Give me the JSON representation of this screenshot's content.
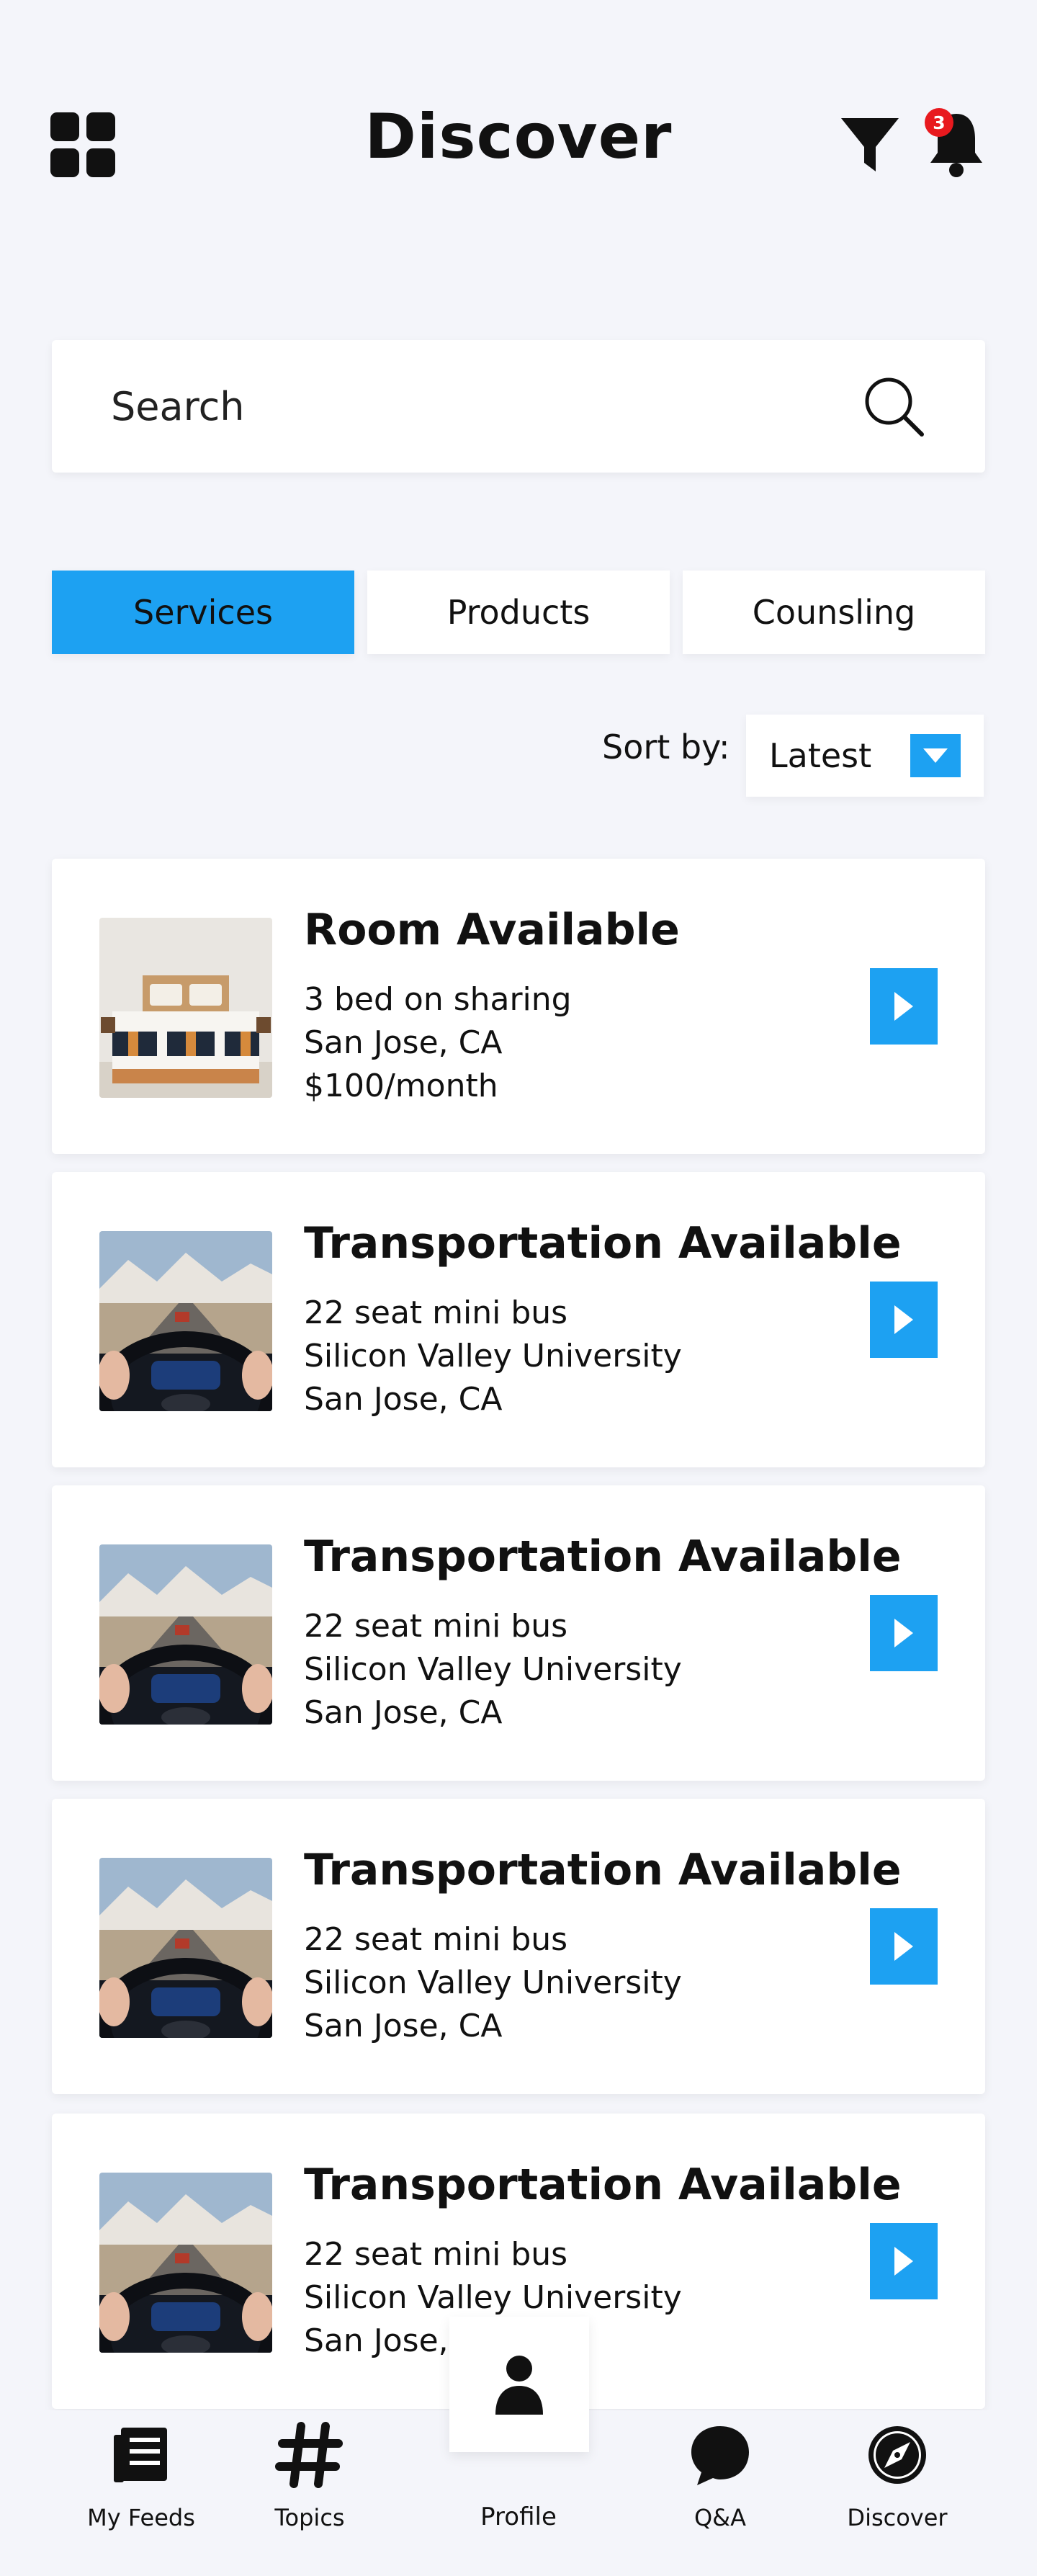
{
  "header": {
    "title": "Discover",
    "notification_count": "3"
  },
  "search": {
    "placeholder": "Search"
  },
  "tabs": [
    {
      "label": "Services",
      "active": true
    },
    {
      "label": "Products",
      "active": false
    },
    {
      "label": "Counsling",
      "active": false
    }
  ],
  "sort": {
    "label": "Sort by:",
    "value": "Latest"
  },
  "listings": [
    {
      "title": "Room Available",
      "line1": "3 bed on sharing",
      "line2": "San Jose, CA",
      "line3": "$100/month",
      "image": "bedroom"
    },
    {
      "title": "Transportation Available",
      "line1": "22 seat mini bus",
      "line2": "Silicon Valley University",
      "line3": "San Jose, CA",
      "image": "steering-wheel"
    },
    {
      "title": "Transportation Available",
      "line1": "22 seat mini bus",
      "line2": "Silicon Valley University",
      "line3": "San Jose, CA",
      "image": "steering-wheel"
    },
    {
      "title": "Transportation Available",
      "line1": "22 seat mini bus",
      "line2": "Silicon Valley University",
      "line3": "San Jose, CA",
      "image": "steering-wheel"
    },
    {
      "title": "Transportation Available",
      "line1": "22 seat mini bus",
      "line2": "Silicon Valley University",
      "line3": "San Jose, CA",
      "image": "steering-wheel"
    }
  ],
  "bottom_nav": {
    "items": [
      {
        "label": "My Feeds",
        "icon": "feed-icon"
      },
      {
        "label": "Topics",
        "icon": "hashtag-icon"
      },
      {
        "label": "Profile",
        "icon": "person-icon"
      },
      {
        "label": "Q&A",
        "icon": "chat-bubble-icon"
      },
      {
        "label": "Discover",
        "icon": "compass-icon"
      }
    ]
  },
  "colors": {
    "accent": "#1da1f2",
    "background": "#f4f5fa",
    "badge": "#e8191e"
  }
}
